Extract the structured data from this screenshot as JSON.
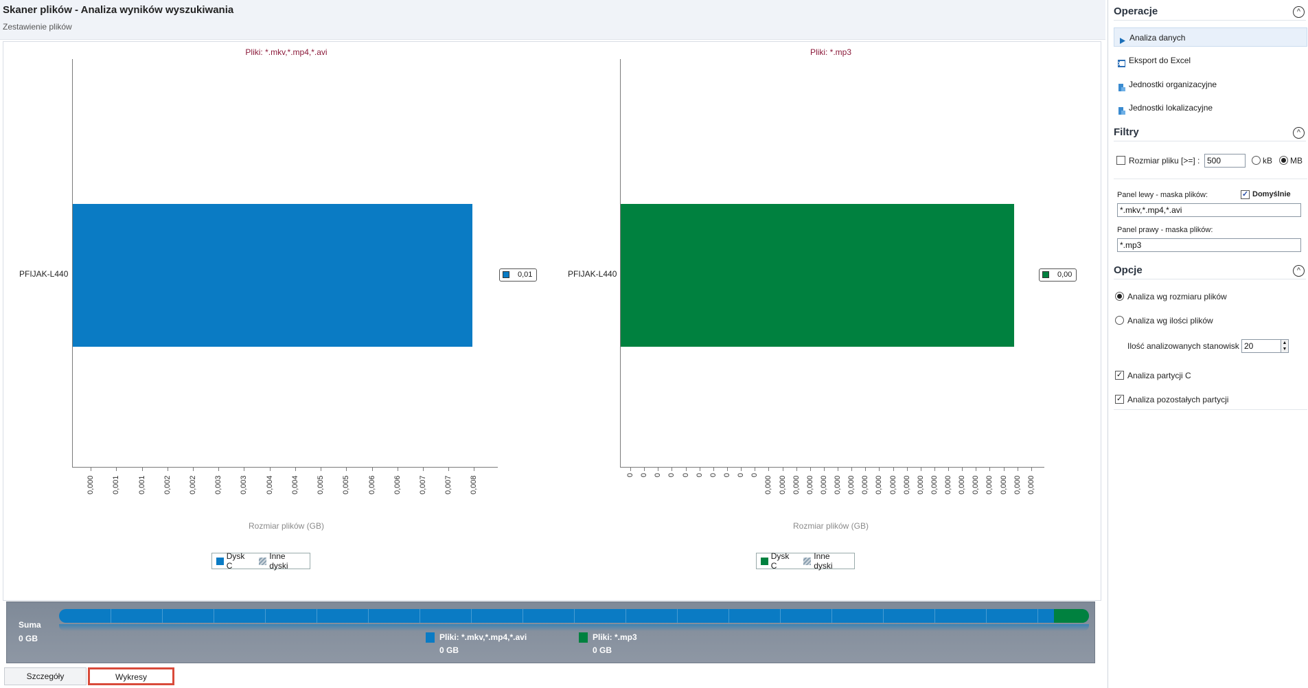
{
  "header": {
    "title": "Skaner plików - Analiza wyników wyszukiwania",
    "subtitle": "Zestawienie plików"
  },
  "chart_data": [
    {
      "type": "bar",
      "orientation": "horizontal",
      "title": "Pliki: *.mkv,*.mp4,*.avi",
      "categories": [
        "PFIJAK-L440"
      ],
      "series": [
        {
          "name": "Dysk C",
          "values": [
            0.008
          ],
          "color": "#0a7bc4"
        }
      ],
      "data_labels": [
        "0,01"
      ],
      "xlabel": "Rozmiar plików (GB)",
      "xlim": [
        0,
        0.0085
      ],
      "x_tick_labels": [
        "0,000",
        "0,001",
        "0,001",
        "0,002",
        "0,002",
        "0,003",
        "0,003",
        "0,004",
        "0,004",
        "0,005",
        "0,005",
        "0,006",
        "0,006",
        "0,007",
        "0,007",
        "0,008"
      ],
      "legend": [
        {
          "label": "Dysk C",
          "color": "#0a7bc4"
        },
        {
          "label": "Inne dyski",
          "color": "hatched"
        }
      ],
      "legend_position": "bottom"
    },
    {
      "type": "bar",
      "orientation": "horizontal",
      "title": "Pliki: *.mp3",
      "categories": [
        "PFIJAK-L440"
      ],
      "series": [
        {
          "name": "Dysk C",
          "values": [
            0.0004
          ],
          "color": "#00813f"
        }
      ],
      "data_labels": [
        "0,00"
      ],
      "xlabel": "Rozmiar plików (GB)",
      "xlim": [
        0,
        0.00043
      ],
      "x_tick_labels": [
        "0",
        "0",
        "0",
        "0",
        "0",
        "0",
        "0",
        "0",
        "0",
        "0",
        "0,000",
        "0,000",
        "0,000",
        "0,000",
        "0,000",
        "0,000",
        "0,000",
        "0,000",
        "0,000",
        "0,000",
        "0,000",
        "0,000",
        "0,000",
        "0,000",
        "0,000",
        "0,000",
        "0,000",
        "0,000",
        "0,000",
        "0,000"
      ],
      "legend": [
        {
          "label": "Dysk C",
          "color": "#00813f"
        },
        {
          "label": "Inne dyski",
          "color": "hatched"
        }
      ],
      "legend_position": "bottom"
    }
  ],
  "summary": {
    "label": "Suma",
    "total": "0 GB",
    "share_left": 0.966,
    "items": [
      {
        "label": "Pliki: *.mkv,*.mp4,*.avi",
        "value": "0 GB",
        "color": "#0a7bc4"
      },
      {
        "label": "Pliki: *.mp3",
        "value": "0 GB",
        "color": "#00813f"
      }
    ]
  },
  "tabs": [
    {
      "label": "Szczegóły"
    },
    {
      "label": "Wykresy"
    }
  ],
  "side": {
    "operations": {
      "title": "Operacje",
      "items": [
        {
          "label": "Analiza danych",
          "icon": "play-icon"
        },
        {
          "label": "Eksport do Excel",
          "icon": "excel-icon"
        },
        {
          "label": "Jednostki organizacyjne",
          "icon": "org-units-icon"
        },
        {
          "label": "Jednostki lokalizacyjne",
          "icon": "location-units-icon"
        }
      ]
    },
    "filters": {
      "title": "Filtry",
      "size_label": "Rozmiar pliku [>=] :",
      "size_value": "500",
      "unit_kb": "kB",
      "unit_mb": "MB",
      "left_mask_label": "Panel lewy - maska plików:",
      "default_label": "Domyślnie",
      "left_mask_value": "*.mkv,*.mp4,*.avi",
      "right_mask_label": "Panel prawy - maska plików:",
      "right_mask_value": "*.mp3"
    },
    "options": {
      "title": "Opcje",
      "by_size": "Analiza wg rozmiaru plików",
      "by_count": "Analiza wg ilości plików",
      "stations_label": "Ilość analizowanych stanowisk",
      "stations_value": "20",
      "partition_c": "Analiza partycji C",
      "other_partitions": "Analiza pozostałych partycji"
    }
  },
  "colors": {
    "accent_blue": "#0a7bc4",
    "accent_green": "#00813f",
    "tab_highlight": "#d94a3a"
  }
}
